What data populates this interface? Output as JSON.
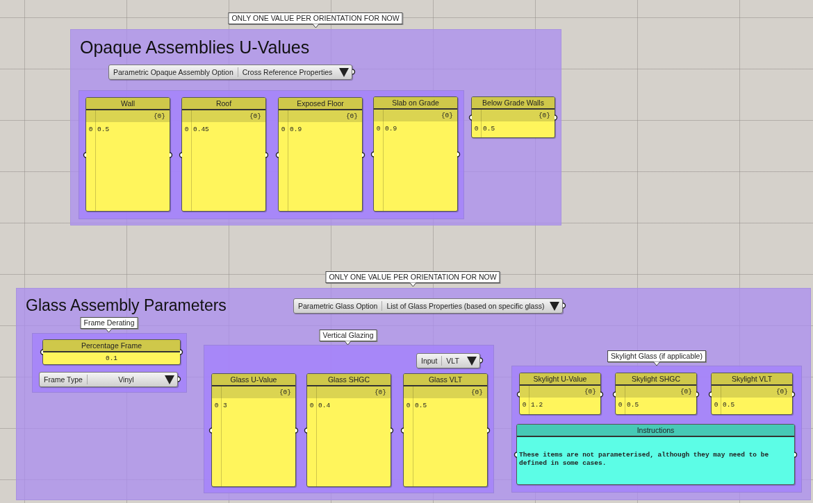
{
  "opaque_group": {
    "callout": "ONLY ONE VALUE PER ORIENTATION FOR NOW",
    "title": "Opaque Assemblies U-Values",
    "selector": {
      "label": "Parametric Opaque Assembly Option",
      "value": "Cross Reference Properties"
    },
    "panels": [
      {
        "title": "Wall",
        "path": "{0}",
        "index": "0",
        "value": "0.5"
      },
      {
        "title": "Roof",
        "path": "{0}",
        "index": "0",
        "value": "0.45"
      },
      {
        "title": "Exposed Floor",
        "path": "{0}",
        "index": "0",
        "value": "0.9"
      },
      {
        "title": "Slab on Grade",
        "path": "{0}",
        "index": "0",
        "value": "0.9"
      },
      {
        "title": "Below Grade Walls",
        "path": "{0}",
        "index": "0",
        "value": "0.5"
      }
    ]
  },
  "glass_group": {
    "callout": "ONLY ONE VALUE PER ORIENTATION FOR NOW",
    "title": "Glass Assembly Parameters",
    "selector": {
      "label": "Parametric Glass Option",
      "value": "List of Glass Properties (based on specific glass)"
    },
    "frame": {
      "callout": "Frame Derating",
      "number": {
        "title": "Percentage Frame",
        "value": "0.1"
      },
      "selector": {
        "label": "Frame Type",
        "value": "Vinyl"
      }
    },
    "vertical": {
      "callout": "Vertical Glazing",
      "selector": {
        "label": "Input",
        "value": "VLT"
      },
      "panels": [
        {
          "title": "Glass U-Value",
          "path": "{0}",
          "index": "0",
          "value": "3"
        },
        {
          "title": "Glass SHGC",
          "path": "{0}",
          "index": "0",
          "value": "0.4"
        },
        {
          "title": "Glass VLT",
          "path": "{0}",
          "index": "0",
          "value": "0.5"
        }
      ]
    },
    "skylight": {
      "callout": "Skylight Glass (if applicable)",
      "panels": [
        {
          "title": "Skylight U-Value",
          "path": "{0}",
          "index": "0",
          "value": "1.2"
        },
        {
          "title": "Skylight SHGC",
          "path": "{0}",
          "index": "0",
          "value": "0.5"
        },
        {
          "title": "Skylight VLT",
          "path": "{0}",
          "index": "0",
          "value": "0.5"
        }
      ],
      "note": {
        "title": "Instructions",
        "text": "These items are not parameterised, although they may need to be defined in some cases."
      }
    }
  }
}
